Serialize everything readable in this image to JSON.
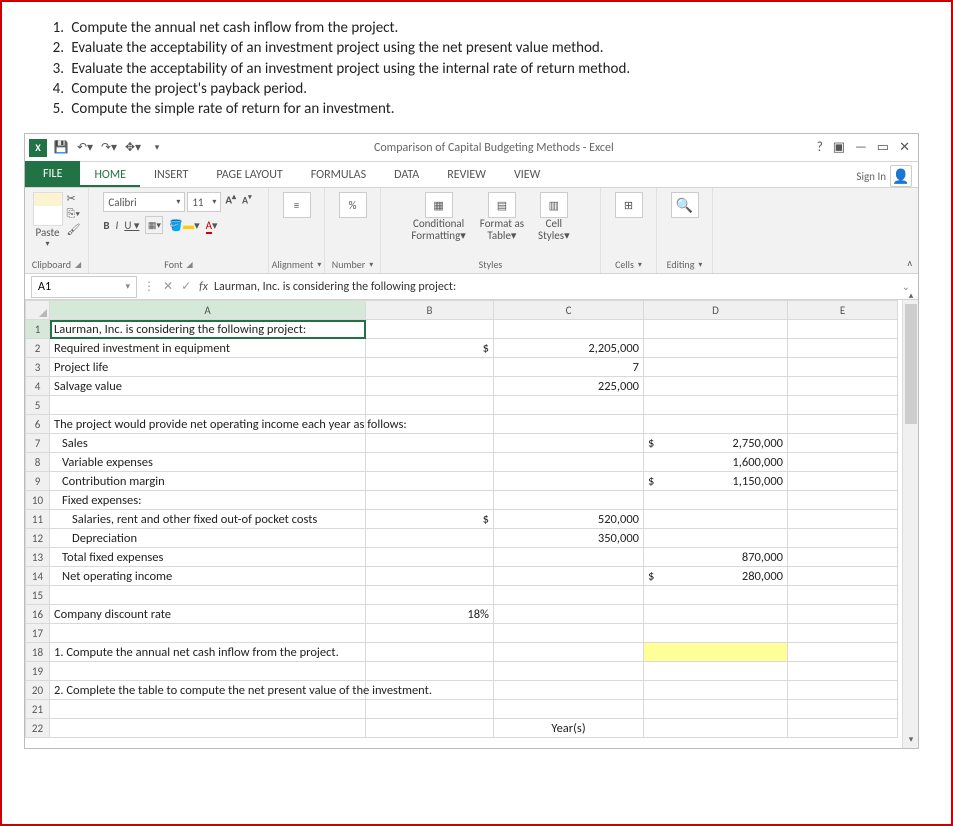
{
  "questions": [
    "Compute the annual net cash inflow from the project.",
    "Evaluate the acceptability of an investment project using the net present value method.",
    "Evaluate the acceptability of an investment project using the internal rate of return method.",
    "Compute the project's payback period.",
    "Compute the simple rate of return for an investment."
  ],
  "title": "Comparison of Capital Budgeting Methods - Excel",
  "signin": "Sign In",
  "tabs": {
    "file": "FILE",
    "home": "HOME",
    "insert": "INSERT",
    "page": "PAGE LAYOUT",
    "formulas": "FORMULAS",
    "data": "DATA",
    "review": "REVIEW",
    "view": "VIEW"
  },
  "ribbon": {
    "paste": "Paste",
    "clipboard": "Clipboard",
    "fontname": "Calibri",
    "fontsize": "11",
    "font": "Font",
    "alignment": "Alignment",
    "number": "Number",
    "cond": "Conditional",
    "cond2": "Formatting",
    "fmt": "Format as",
    "fmt2": "Table",
    "cell": "Cell",
    "cell2": "Styles",
    "styles": "Styles",
    "cells": "Cells",
    "editing": "Editing"
  },
  "namebox": "A1",
  "fcontent": "Laurman, Inc. is considering the following project:",
  "cols": [
    "A",
    "B",
    "C",
    "D",
    "E"
  ],
  "rows": {
    "1": {
      "A": "Laurman, Inc. is considering the following project:"
    },
    "2": {
      "A": "Required investment in equipment",
      "B": "$",
      "C": "2,205,000"
    },
    "3": {
      "A": "Project life",
      "C": "7"
    },
    "4": {
      "A": "Salvage value",
      "C": "225,000"
    },
    "6": {
      "A": "The project would provide net operating income each year as follows:"
    },
    "7": {
      "A": "Sales",
      "Ds": "$",
      "D": "2,750,000"
    },
    "8": {
      "A": "Variable expenses",
      "D": "1,600,000"
    },
    "9": {
      "A": "Contribution margin",
      "Ds": "$",
      "D": "1,150,000"
    },
    "10": {
      "A": "Fixed expenses:"
    },
    "11": {
      "A": "Salaries, rent and other fixed out-of pocket costs",
      "B": "$",
      "C": "520,000"
    },
    "12": {
      "A": "Depreciation",
      "C": "350,000"
    },
    "13": {
      "A": "Total fixed expenses",
      "D": "870,000"
    },
    "14": {
      "A": "Net operating income",
      "Ds": "$",
      "D": "280,000"
    },
    "16": {
      "A": "Company discount rate",
      "B": "18%"
    },
    "18": {
      "A": "1. Compute the annual net cash inflow from the project."
    },
    "20": {
      "A": "2. Complete the table to compute the net present value of the investment."
    },
    "22": {
      "C": "Year(s)"
    }
  }
}
